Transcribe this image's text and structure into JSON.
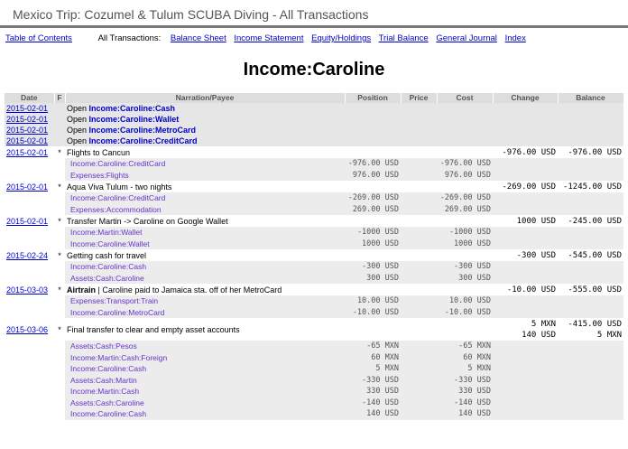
{
  "header": {
    "title": "Mexico Trip: Cozumel & Tulum SCUBA Diving - All Transactions"
  },
  "nav": {
    "toc": "Table of Contents",
    "label": "All Transactions:",
    "links": [
      "Balance Sheet",
      "Income Statement",
      "Equity/Holdings",
      "Trial Balance",
      "General Journal",
      "Index"
    ]
  },
  "page_title": "Income:Caroline",
  "table": {
    "columns": [
      "Date",
      "F",
      "Narration/Payee",
      "Position",
      "Price",
      "Cost",
      "Change",
      "Balance"
    ],
    "opens": [
      {
        "date": "2015-02-01",
        "prefix": "Open ",
        "account": "Income:Caroline:Cash"
      },
      {
        "date": "2015-02-01",
        "prefix": "Open ",
        "account": "Income:Caroline:Wallet"
      },
      {
        "date": "2015-02-01",
        "prefix": "Open ",
        "account": "Income:Caroline:MetroCard"
      },
      {
        "date": "2015-02-01",
        "prefix": "Open ",
        "account": "Income:Caroline:CreditCard"
      }
    ],
    "transactions": [
      {
        "date": "2015-02-01",
        "flag": "*",
        "payee": "",
        "narration": "Flights to Cancun",
        "change": "-976.00 USD",
        "balance": "-976.00 USD",
        "postings": [
          {
            "account": "Income:Caroline:CreditCard",
            "position": "-976.00 USD",
            "cost": "-976.00 USD"
          },
          {
            "account": "Expenses:Flights",
            "position": "976.00 USD",
            "cost": "976.00 USD"
          }
        ]
      },
      {
        "date": "2015-02-01",
        "flag": "*",
        "payee": "",
        "narration": "Aqua Viva Tulum - two nights",
        "change": "-269.00 USD",
        "balance": "-1245.00 USD",
        "postings": [
          {
            "account": "Income:Caroline:CreditCard",
            "position": "-269.00 USD",
            "cost": "-269.00 USD"
          },
          {
            "account": "Expenses:Accommodation",
            "position": "269.00 USD",
            "cost": "269.00 USD"
          }
        ]
      },
      {
        "date": "2015-02-01",
        "flag": "*",
        "payee": "",
        "narration": "Transfer Martin -> Caroline on Google Wallet",
        "change": "1000 USD",
        "balance": "-245.00 USD",
        "postings": [
          {
            "account": "Income:Martin:Wallet",
            "position": "-1000 USD",
            "cost": "-1000 USD"
          },
          {
            "account": "Income:Caroline:Wallet",
            "position": "1000 USD",
            "cost": "1000 USD"
          }
        ]
      },
      {
        "date": "2015-02-24",
        "flag": "*",
        "payee": "",
        "narration": "Getting cash for travel",
        "change": "-300 USD",
        "balance": "-545.00 USD",
        "postings": [
          {
            "account": "Income:Caroline:Cash",
            "position": "-300 USD",
            "cost": "-300 USD"
          },
          {
            "account": "Assets:Cash:Caroline",
            "position": "300 USD",
            "cost": "300 USD"
          }
        ]
      },
      {
        "date": "2015-03-03",
        "flag": "*",
        "payee": "Airtrain",
        "narration": " | Caroline paid to Jamaica sta. off of her MetroCard",
        "change": "-10.00 USD",
        "balance": "-555.00 USD",
        "postings": [
          {
            "account": "Expenses:Transport:Train",
            "position": "10.00 USD",
            "cost": "10.00 USD"
          },
          {
            "account": "Income:Caroline:MetroCard",
            "position": "-10.00 USD",
            "cost": "-10.00 USD"
          }
        ]
      },
      {
        "date": "2015-03-06",
        "flag": "*",
        "payee": "",
        "narration": "Final transfer to clear and empty asset accounts",
        "change": "5 MXN",
        "change2": "140 USD",
        "balance": "-415.00 USD",
        "balance2": "5 MXN",
        "postings": [
          {
            "account": "Assets:Cash:Pesos",
            "position": "-65 MXN",
            "cost": "-65 MXN"
          },
          {
            "account": "Income:Martin:Cash:Foreign",
            "position": "60 MXN",
            "cost": "60 MXN"
          },
          {
            "account": "Income:Caroline:Cash",
            "position": "5 MXN",
            "cost": "5 MXN"
          },
          {
            "account": "Assets:Cash:Martin",
            "position": "-330 USD",
            "cost": "-330 USD"
          },
          {
            "account": "Income:Martin:Cash",
            "position": "330 USD",
            "cost": "330 USD"
          },
          {
            "account": "Assets:Cash:Caroline",
            "position": "-140 USD",
            "cost": "-140 USD"
          },
          {
            "account": "Income:Caroline:Cash",
            "position": "140 USD",
            "cost": "140 USD"
          }
        ]
      }
    ]
  }
}
